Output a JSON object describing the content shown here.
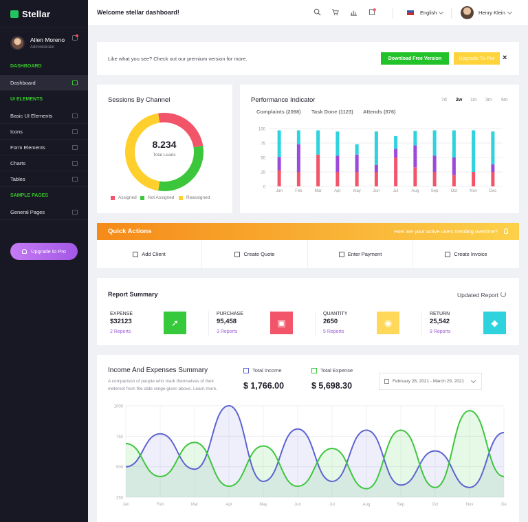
{
  "brand": {
    "name": "Stellar",
    "color": "#22c55e"
  },
  "sidebar": {
    "user": {
      "name": "Allen Moreno",
      "role": "Administrator"
    },
    "sections": [
      {
        "label": "DASHBOARD",
        "items": [
          {
            "label": "Dashboard",
            "icon": "monitor-icon",
            "active": true
          }
        ]
      },
      {
        "label": "UI ELEMENTS",
        "items": [
          {
            "label": "Basic UI Elements",
            "icon": "cube-icon"
          },
          {
            "label": "Icons",
            "icon": "globe-icon"
          },
          {
            "label": "Form Elements",
            "icon": "form-icon"
          },
          {
            "label": "Charts",
            "icon": "bar-chart-icon"
          },
          {
            "label": "Tables",
            "icon": "grid-icon"
          }
        ]
      },
      {
        "label": "SAMPLE PAGES",
        "items": [
          {
            "label": "General Pages",
            "icon": "file-icon"
          }
        ]
      }
    ],
    "upgrade_label": "Upgrade to Pro"
  },
  "topbar": {
    "welcome": "Welcome stellar dashboard!",
    "icons": [
      "search-icon",
      "cart-icon",
      "chart-icon",
      "notifications-icon"
    ],
    "language": "English",
    "user_name": "Henry Klein"
  },
  "banner": {
    "text": "Like what you see? Check out our premium version for more.",
    "download_label": "Download Free Version",
    "upgrade_label": "Upgrade To Pro",
    "close": "×"
  },
  "sessions": {
    "title": "Sessions By Channel",
    "total_value": "8.234",
    "total_label": "Total Leads",
    "legend": [
      {
        "label": "Assigned",
        "color": "#f2556a"
      },
      {
        "label": "Not Assigned",
        "color": "#3cc63c"
      },
      {
        "label": "Reassigned",
        "color": "#ffcf2e"
      }
    ]
  },
  "performance": {
    "title": "Performance Indicator",
    "ranges": [
      "7d",
      "2w",
      "1m",
      "3m",
      "6m"
    ],
    "active_range": "2w",
    "stats": [
      {
        "label": "Complaints",
        "value": "(2098)"
      },
      {
        "label": "Task Done",
        "value": "(1123)"
      },
      {
        "label": "Attends",
        "value": "(876)"
      }
    ]
  },
  "quick_actions": {
    "title": "Quick Actions",
    "question": "How are your active users trending overtime?",
    "actions": [
      {
        "label": "Add Client",
        "icon": "user-icon"
      },
      {
        "label": "Create Quote",
        "icon": "quote-icon"
      },
      {
        "label": "Enter Payment",
        "icon": "payment-icon"
      },
      {
        "label": "Create Invoice",
        "icon": "invoice-icon"
      }
    ]
  },
  "report": {
    "title": "Report Summary",
    "updated_label": "Updated Report",
    "stats": [
      {
        "label": "EXPENSE",
        "value": "$32123",
        "link": "2 Reports",
        "color": "#36c93c",
        "icon": "rocket-icon",
        "glyph": "➚"
      },
      {
        "label": "PURCHASE",
        "value": "95,458",
        "link": "3 Reports",
        "color": "#f2556a",
        "icon": "briefcase-icon",
        "glyph": "▣"
      },
      {
        "label": "QUANTITY",
        "value": "2650",
        "link": "5 Reports",
        "color": "#ffd85a",
        "icon": "pin-icon",
        "glyph": "◉"
      },
      {
        "label": "RETURN",
        "value": "25,542",
        "link": "9 Reports",
        "color": "#2ed3de",
        "icon": "diamond-icon",
        "glyph": "◆"
      }
    ]
  },
  "income": {
    "title": "Income And Expenses Summary",
    "subtitle": "A comparison of people who mark themselves of their ineterest from the date range given above. Learn more.",
    "legend": [
      {
        "label": "Total Income",
        "amount": "$ 1,766.00",
        "color": "#5c63d1"
      },
      {
        "label": "Total Expense",
        "amount": "$ 5,698.30",
        "color": "#3cc63c"
      }
    ],
    "date_range": "February 28, 2021 - March 29, 2021"
  },
  "chart_data": [
    {
      "type": "pie",
      "title": "Sessions By Channel",
      "categories": [
        "Assigned",
        "Not Assigned",
        "Reassigned"
      ],
      "values": [
        25,
        30,
        45
      ],
      "colors": [
        "#f2556a",
        "#3cc63c",
        "#ffcf2e"
      ]
    },
    {
      "type": "bar",
      "title": "Performance Indicator",
      "categories": [
        "Jan",
        "Feb",
        "Mar",
        "Apr",
        "may",
        "Jun",
        "Jul",
        "Aug",
        "Sep",
        "Oct",
        "Nov",
        "Dec"
      ],
      "ylim": [
        0,
        100
      ],
      "yticks": [
        0,
        25,
        50,
        75,
        100
      ],
      "series": [
        {
          "name": "Complaints",
          "color": "#f2556a",
          "values": [
            28,
            25,
            55,
            25,
            25,
            25,
            50,
            33,
            25,
            20,
            25,
            25
          ]
        },
        {
          "name": "Task Done",
          "color": "#9b4ad9",
          "values": [
            23,
            48,
            0,
            28,
            30,
            12,
            15,
            38,
            28,
            30,
            0,
            13
          ]
        },
        {
          "name": "Attends",
          "color": "#2ed3de",
          "values": [
            46,
            24,
            42,
            42,
            18,
            58,
            22,
            25,
            44,
            47,
            72,
            57
          ]
        }
      ]
    },
    {
      "type": "area",
      "title": "Income And Expenses Summary",
      "categories": [
        "Jan",
        "Feb",
        "Mar",
        "Apr",
        "May",
        "Jun",
        "Jul",
        "Aug",
        "Sep",
        "Oct",
        "Nov",
        "De"
      ],
      "ylim": [
        250,
        1000
      ],
      "yticks": [
        250,
        500,
        750,
        1000
      ],
      "series": [
        {
          "name": "Total Income",
          "color": "#5c63d1",
          "values": [
            500,
            770,
            480,
            1000,
            380,
            810,
            380,
            800,
            350,
            630,
            330,
            780
          ]
        },
        {
          "name": "Total Expense",
          "color": "#3cc63c",
          "values": [
            690,
            420,
            700,
            340,
            670,
            340,
            650,
            320,
            800,
            330,
            960,
            420
          ]
        }
      ]
    }
  ]
}
